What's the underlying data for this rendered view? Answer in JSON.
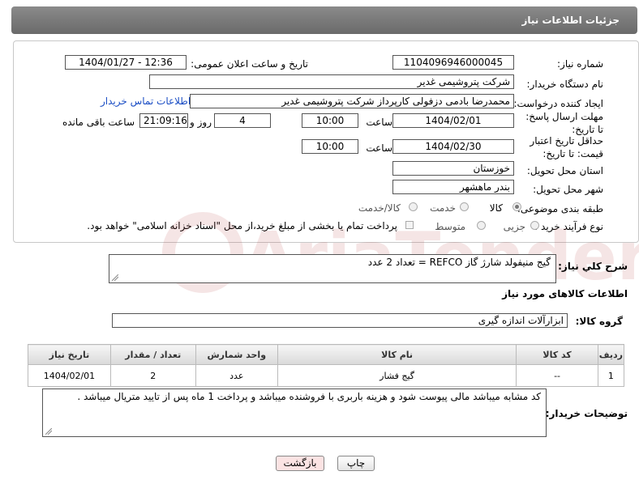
{
  "header": {
    "title": "جزئیات اطلاعات نیاز"
  },
  "form": {
    "need_number_label": "شماره نیاز:",
    "need_number": "1104096946000045",
    "announce_label": "تاریخ و ساعت اعلان عمومی:",
    "announce_value": "1404/01/27 - 12:36",
    "buyer_org_label": "نام دستگاه خریدار:",
    "buyer_org": "شرکت پتروشیمی غدیر",
    "creator_label": "ایجاد کننده درخواست:",
    "creator": "محمدرضا بادمی دزفولی کارپرداز شرکت پتروشیمی غدیر",
    "buyer_contact_link": "اطلاعات تماس خریدار",
    "reply_deadline_label": "مهلت ارسال پاسخ: تا تاریخ:",
    "reply_date": "1404/02/01",
    "time_label": "ساعت",
    "reply_time": "10:00",
    "days_value": "4",
    "days_label": "روز و",
    "remaining_time": "21:09:16",
    "remaining_label": "ساعت باقی مانده",
    "price_validity_label": "حداقل تاریخ اعتبار قیمت: تا تاریخ:",
    "price_date": "1404/02/30",
    "price_time": "10:00",
    "province_label": "استان محل تحویل:",
    "province": "خوزستان",
    "city_label": "شهر محل تحویل:",
    "city": "بندر ماهشهر",
    "category_label": "طبقه بندی موضوعی:",
    "category_options": [
      "کالا",
      "خدمت",
      "کالا/خدمت"
    ],
    "process_label": "نوع فرآیند خرید :",
    "process_options": [
      "جزیی",
      "متوسط"
    ],
    "payment_note": "پرداخت تمام یا بخشی از مبلغ خرید،از محل \"اسناد خزانه اسلامی\" خواهد بود."
  },
  "description": {
    "label": "شرح کلي نياز:",
    "value": "گیج منیفولد شارژ گاز REFCO = تعداد 2 عدد"
  },
  "goods_section": {
    "title": "اطلاعات کالاهای مورد نیاز",
    "group_label": "گروه کالا:",
    "group_value": "ابزارآلات اندازه گیری"
  },
  "table": {
    "headers": [
      "ردیف",
      "کد کالا",
      "نام کالا",
      "واحد شمارش",
      "تعداد / مقدار",
      "تاریخ نیاز"
    ],
    "rows": [
      {
        "row": "1",
        "code": "--",
        "name": "گیج فشار",
        "unit": "عدد",
        "qty": "2",
        "date": "1404/02/01"
      }
    ]
  },
  "buyer_notes": {
    "label": "توضیحات خریدار:",
    "value": "کد مشابه میباشد مالی پیوست شود و هزینه باربری با فروشنده میباشد و پرداخت 1 ماه پس از تایید متریال میباشد ."
  },
  "buttons": {
    "print": "چاپ",
    "back": "بازگشت"
  },
  "watermark": {
    "text": "AriaTender.net"
  },
  "colors": {
    "header_bg": "#7a7a7a",
    "link": "#1a4dc4",
    "back_button": "#fbe3e3"
  }
}
